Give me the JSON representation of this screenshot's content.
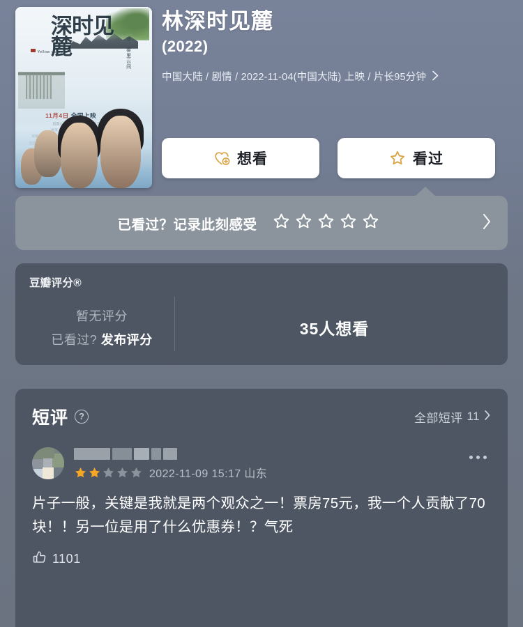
{
  "movie": {
    "title": "林深时见麓",
    "year": "(2022)",
    "meta": "中国大陆 / 剧情 / 2022-11-04(中国大陆) 上映 / 片长95分钟",
    "meta_chevron": "chevron-right-icon",
    "poster": {
      "calligraphy_title": "深时见麓",
      "side_text_1": "守．雾里云间",
      "side_text_2": "望．人间真杏",
      "release_date": "11月4日",
      "release_label": "全国上映",
      "brand_label": "Yellow valley",
      "credits": [
        "出品人 李文瑞 胡梦婷 江永康 江山 杨宗海",
        "导演 王平  编剧 lim  摄影 纪伟  美术指导 张武",
        "剪辑 张波  录音 江波  特效  林之洲  出品公司  云南翠林影视传媒有限公司",
        "出品公司  云南省翠林影视文化传媒有限公司  联合出品  广西广电影视制作中心"
      ]
    }
  },
  "actions": {
    "want_to_watch": {
      "label": "想看",
      "icon": "heart-plus-icon"
    },
    "watched": {
      "label": "看过",
      "icon": "star-outline-icon"
    }
  },
  "rating_prompt": {
    "text": "已看过？记录此刻感受",
    "stars_total": 5,
    "stars_filled": 0,
    "chevron": "chevron-right-icon"
  },
  "douban_rating": {
    "section_title": "豆瓣评分®",
    "no_score": "暂无评分",
    "post_prefix": "已看过?",
    "post_action": "发布评分",
    "want_count": "35人想看"
  },
  "comments": {
    "title": "短评",
    "help_icon": "question-mark-icon",
    "all_label": "全部短评",
    "all_count": "11",
    "chevron": "chevron-right-icon",
    "items": [
      {
        "username_redacted": true,
        "avatar_redacted": true,
        "stars_filled": 2,
        "stars_total": 5,
        "date": "2022-11-09 15:17 山东",
        "text": "片子一般，关键是我就是两个观众之一！票房75元，我一个人贡献了70块！！另一位是用了什么优惠券！？气死",
        "like_icon": "thumbs-up-icon",
        "like_count": "1101",
        "more_icon": "more-horizontal-icon"
      }
    ]
  },
  "colors": {
    "page_bg": "#6f7886",
    "card_bg": "#4e5663",
    "prompt_bg": "#8b939d",
    "accent_star": "#f5a623",
    "button_bg": "#ffffff",
    "text_primary": "#ffffff",
    "text_secondary": "#b9c0ca"
  }
}
